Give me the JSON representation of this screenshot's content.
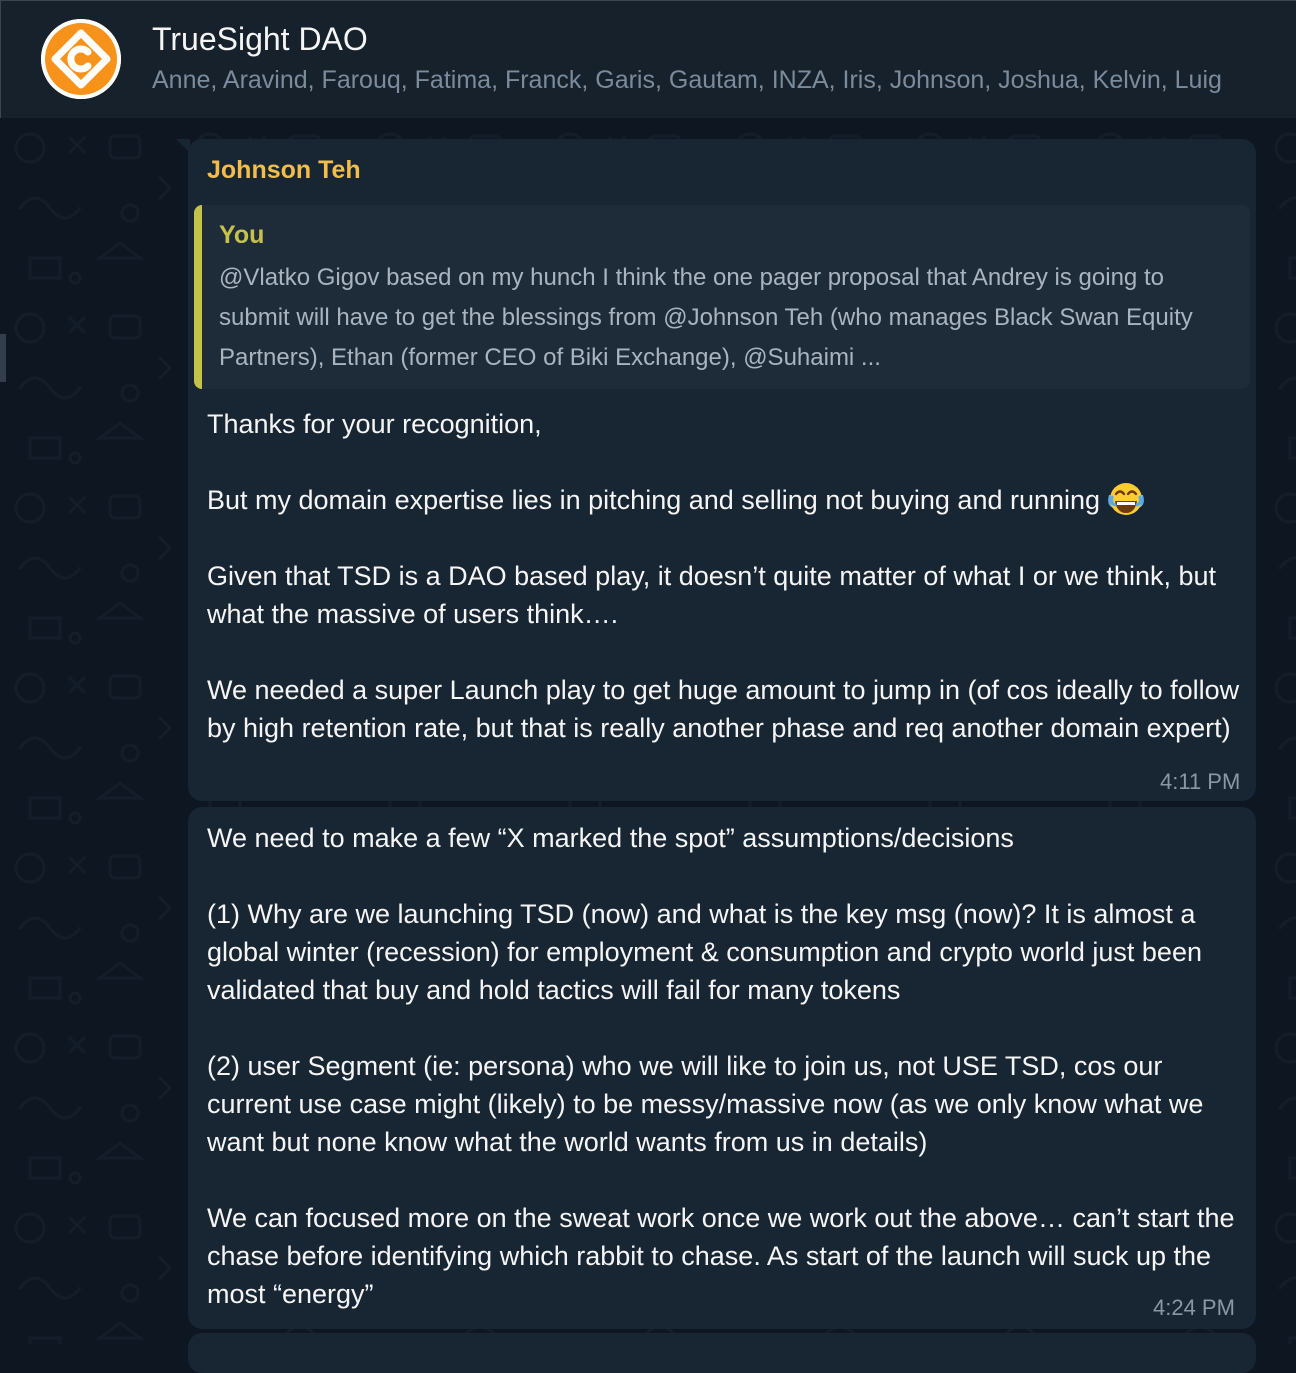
{
  "header": {
    "avatar_icon": "truesight-dao-logo-icon",
    "title": "TrueSight DAO",
    "members": "Anne, Aravind, Farouq, Fatima, Franck, Garis, Gautam, INZA, Iris, Johnson, Joshua, Kelvin, Luig"
  },
  "messages": [
    {
      "sender": "Johnson Teh",
      "reply": {
        "author": "You",
        "text": "@Vlatko Gigov based on my hunch I think the one pager proposal that Andrey is going to submit will have to get the blessings from @Johnson Teh (who manages Black Swan Equity Partners), Ethan (former CEO of Biki Exchange), @Suhaimi ..."
      },
      "text_before_emoji": "Thanks for your recognition,\n\nBut my domain expertise lies in pitching and selling not buying and running",
      "emoji": "face-with-tears-of-joy-icon",
      "text_after_emoji": "\n\nGiven that TSD is a DAO based play, it doesn’t quite matter of what I or we think, but what the massive of users think….\n\nWe needed a super Launch play to get huge amount to jump in (of cos ideally to follow by high retention rate, but that is really another phase and req another domain expert)",
      "time": "4:11 PM"
    },
    {
      "text": "We need to make a few “X marked the spot” assumptions/decisions\n\n(1) Why are we launching TSD (now) and what is the key msg (now)? It is almost a global winter (recession) for employment & consumption and crypto world just been validated that buy and hold tactics will fail for many tokens\n\n(2) user Segment (ie: persona) who we will like to join us, not USE TSD, cos our current use case might (likely) to be messy/massive now (as we only know what we want but none know what the world wants from us in details)\n\nWe can focused more on the sweat work once we work out the above… can’t start the chase before identifying which rabbit to chase. As start of the launch will suck up the most “energy”",
      "time": "4:24 PM"
    }
  ],
  "colors": {
    "background": "#0e1621",
    "header_bg": "#17212b",
    "bubble_bg": "#182533",
    "sender_name": "#f2bd4b",
    "reply_accent": "#c5c24a",
    "avatar_orange": "#f7931a"
  }
}
